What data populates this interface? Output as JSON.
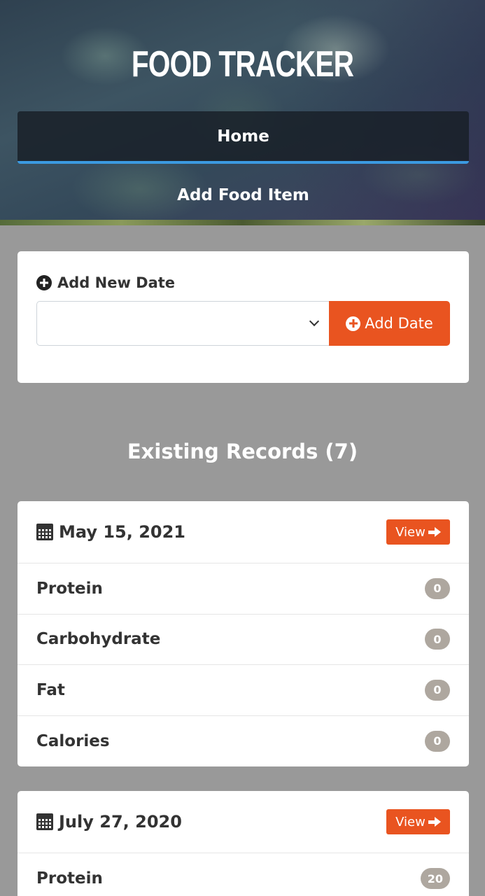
{
  "header": {
    "title": "FOOD TRACKER",
    "nav": [
      {
        "label": "Home"
      },
      {
        "label": "Add Food Item"
      }
    ]
  },
  "add_date": {
    "label": "Add New Date",
    "select_value": "",
    "button_label": "Add Date"
  },
  "records": {
    "title": "Existing Records (7)",
    "items": [
      {
        "date": "May 15, 2021",
        "view_label": "View",
        "rows": [
          {
            "label": "Protein",
            "value": "0"
          },
          {
            "label": "Carbohydrate",
            "value": "0"
          },
          {
            "label": "Fat",
            "value": "0"
          },
          {
            "label": "Calories",
            "value": "0"
          }
        ]
      },
      {
        "date": "July 27, 2020",
        "view_label": "View",
        "rows": [
          {
            "label": "Protein",
            "value": "20"
          }
        ]
      }
    ]
  },
  "colors": {
    "accent": "#e95420",
    "nav_active": "#3b9ae1",
    "badge": "#aea79f",
    "background": "#999999"
  }
}
